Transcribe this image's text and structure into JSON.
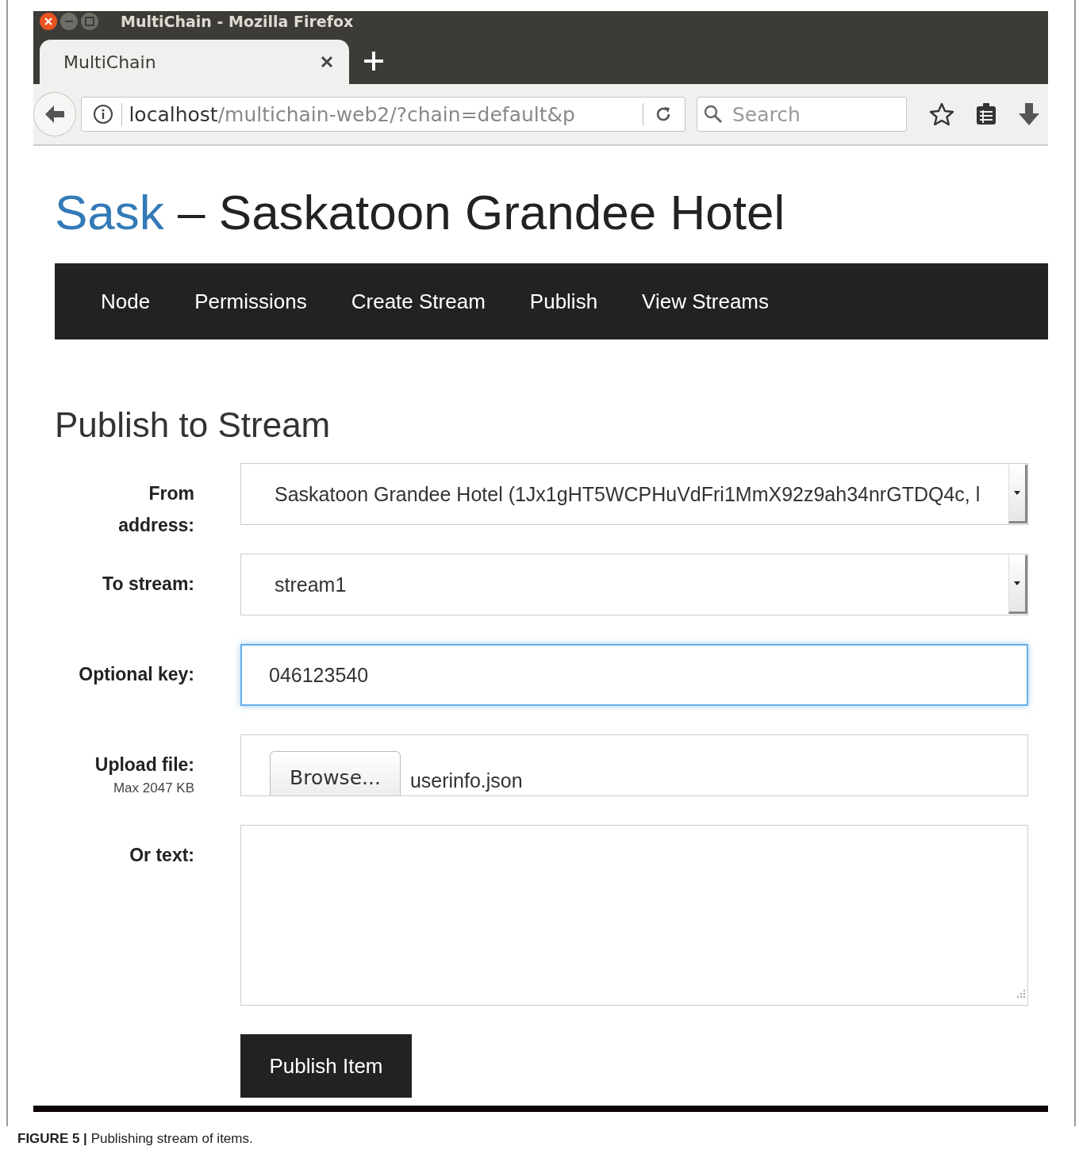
{
  "window": {
    "title": "MultiChain - Mozilla Firefox"
  },
  "tabs": [
    {
      "label": "MultiChain",
      "selected": true
    }
  ],
  "address_bar": {
    "host": "localhost",
    "path": "/multichain-web2/?chain=default&p"
  },
  "search": {
    "placeholder": "Search"
  },
  "site": {
    "brand": "Sask",
    "title": "– Saskatoon Grandee Hotel"
  },
  "nav": [
    "Node",
    "Permissions",
    "Create Stream",
    "Publish",
    "View Streams"
  ],
  "page_title": "Publish to Stream",
  "form": {
    "fields": [
      {
        "kind": "select",
        "label": "From address:",
        "value": "Saskatoon Grandee Hotel (1Jx1gHT5WCPHuVdFri1MmX92z9ah34nrGTDQ4c, l",
        "focused": false
      },
      {
        "kind": "select",
        "label": "To stream:",
        "value": "stream1",
        "focused": false
      },
      {
        "kind": "text",
        "label": "Optional key:",
        "value": "046123540",
        "focused": true
      },
      {
        "kind": "file",
        "label": "Upload file:",
        "note": "Max 2047 KB",
        "button": "Browse...",
        "value": "userinfo.json",
        "focused": false
      },
      {
        "kind": "textarea",
        "label": "Or text:",
        "focused": false
      }
    ],
    "submit": "Publish Item"
  },
  "caption": {
    "label": "FIGURE 5 |",
    "text": "Publishing stream of items."
  }
}
